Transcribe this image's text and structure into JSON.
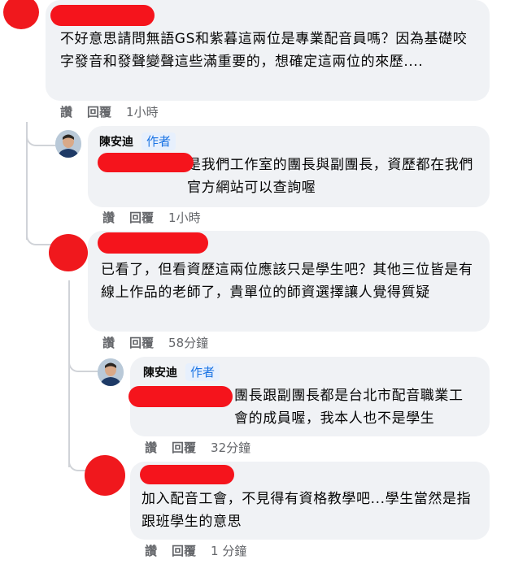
{
  "comments": [
    {
      "author": "",
      "badge": "",
      "text": "不好意思請問無語GS和紫暮這兩位是專業配音員嗎？因為基礎咬字發音和發聲變聲這些滿重要的，想確定這兩位的來歷....",
      "like": "讚",
      "reply": "回覆",
      "time": "1小時"
    },
    {
      "author": "陳安迪",
      "badge": "作者",
      "text": "是我們工作室的團長與副團長，資歷都在我們官方網站可以查詢喔",
      "like": "讚",
      "reply": "回覆",
      "time": "1小時"
    },
    {
      "author": "",
      "badge": "",
      "text": "已看了，但看資歷這兩位應該只是學生吧？其他三位皆是有線上作品的老師了，貴單位的師資選擇讓人覺得質疑",
      "like": "讚",
      "reply": "回覆",
      "time": "58分鐘"
    },
    {
      "author": "陳安迪",
      "badge": "作者",
      "text": "團長跟副團長都是台北市配音職業工會的成員喔，我本人也不是學生",
      "like": "讚",
      "reply": "回覆",
      "time": "32分鐘"
    },
    {
      "author": "",
      "badge": "",
      "text": "加入配音工會，不見得有資格教學吧...學生當然是指跟班學生的意思",
      "like": "讚",
      "reply": "回覆",
      "time": "1 分鐘"
    }
  ]
}
